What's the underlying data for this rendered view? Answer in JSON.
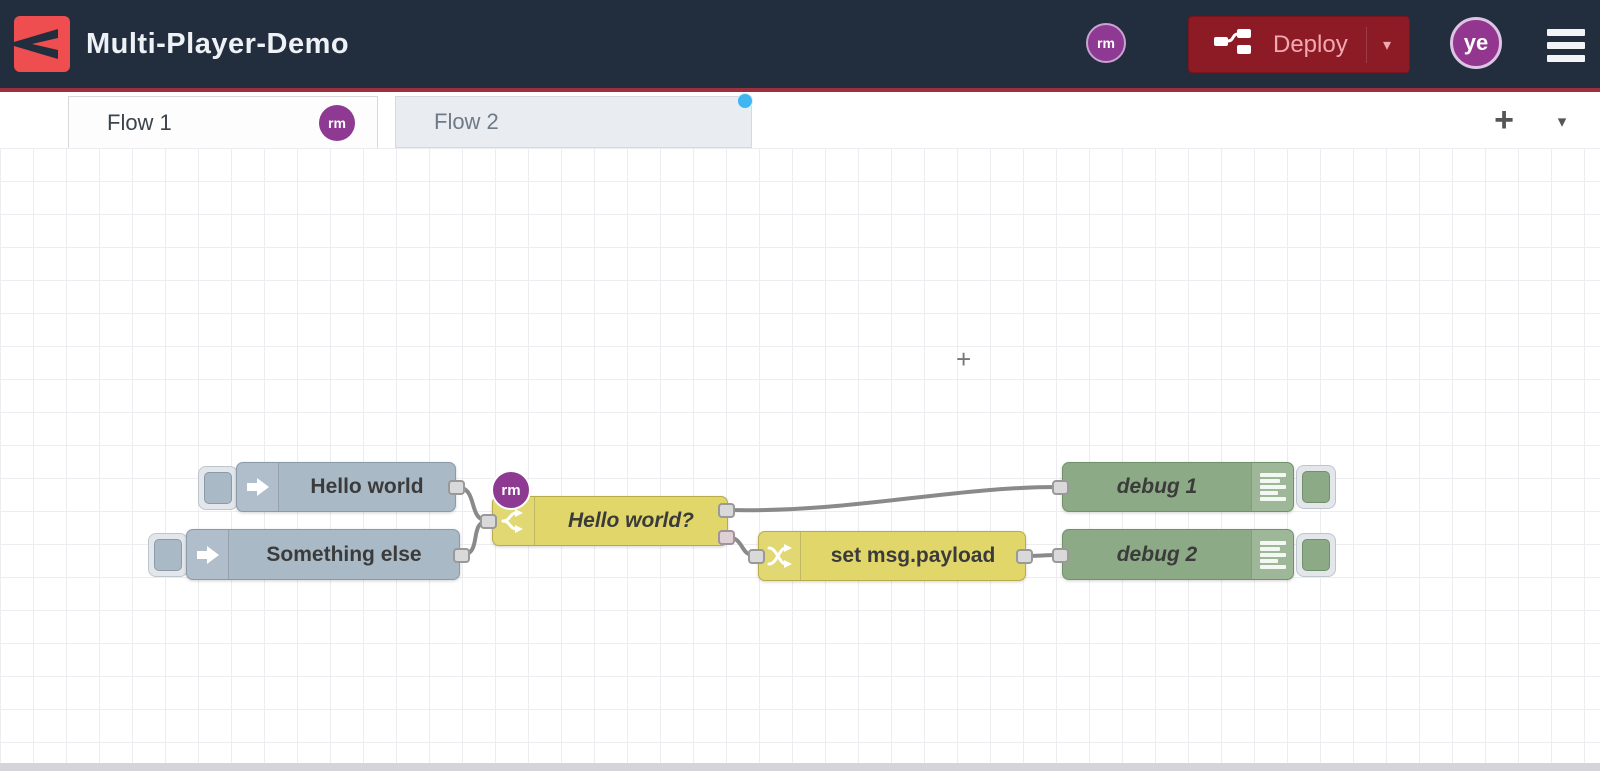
{
  "header": {
    "logo_icon": "node-red-logo",
    "title": "Multi-Player-Demo",
    "collaborator_avatar": "rm",
    "deploy": {
      "label": "Deploy",
      "caret": "▾"
    },
    "user_avatar": "ye",
    "menu_icon": "hamburger"
  },
  "tab_bar": {
    "tabs": [
      {
        "label": "Flow 1",
        "badge": "rm",
        "active": true,
        "modified": false
      },
      {
        "label": "Flow 2",
        "badge": null,
        "active": false,
        "modified": true
      }
    ],
    "add_label": "+",
    "list_caret": "▾"
  },
  "canvas": {
    "cursor_glyph": "+",
    "nodes": [
      {
        "id": "inject-hello-world",
        "type": "inject",
        "label": "Hello world"
      },
      {
        "id": "inject-something-else",
        "type": "inject",
        "label": "Something else"
      },
      {
        "id": "switch-hello-world",
        "type": "switch",
        "label": "Hello world?",
        "badge": "rm",
        "outputs": 2
      },
      {
        "id": "change-set-msg-payload",
        "type": "change",
        "label": "set msg.payload"
      },
      {
        "id": "debug-1",
        "type": "debug",
        "label": "debug 1"
      },
      {
        "id": "debug-2",
        "type": "debug",
        "label": "debug 2"
      }
    ],
    "wires": [
      "inject-hello-world → switch-hello-world",
      "inject-something-else → switch-hello-world",
      "switch-hello-world:1 → debug-1",
      "switch-hello-world:2 → change-set-msg-payload",
      "change-set-msg-payload → debug-2"
    ]
  },
  "colors": {
    "header_bg": "#222d3d",
    "accent_red_rule": "#9e2f3e",
    "logo_red": "#ef4e50",
    "deploy_button_red": "#8c1b25",
    "avatar_purple": "#8e3a92",
    "inject_node": "#a9bac6",
    "function_yellow": "#e0d669",
    "debug_green": "#8caa86",
    "modified_dot_blue": "#3fb6f0",
    "wire_gray": "#8a8a8a"
  }
}
